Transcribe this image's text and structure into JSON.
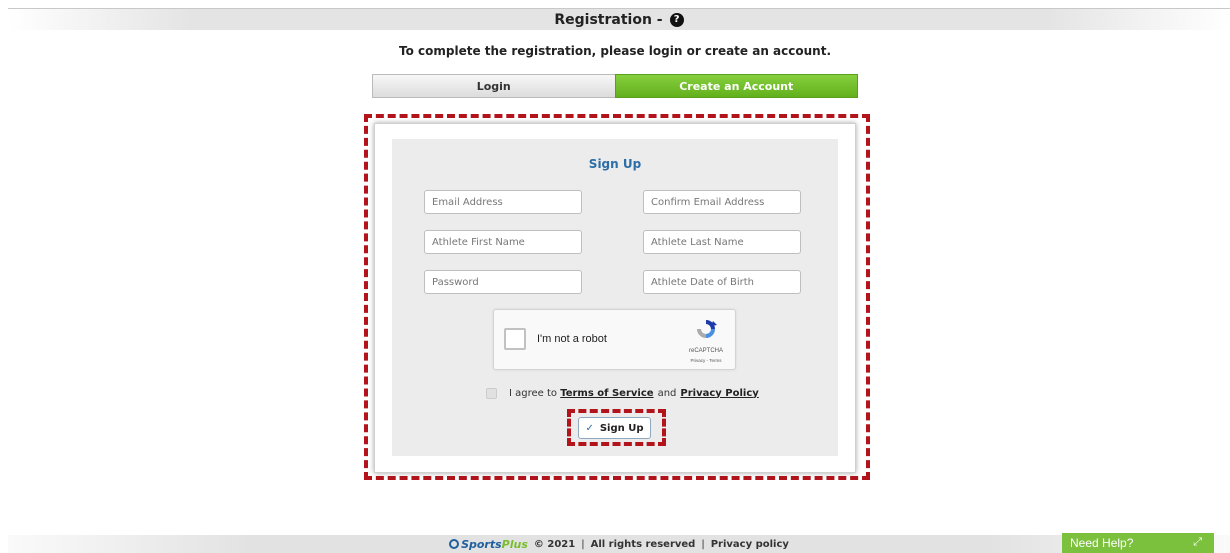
{
  "header": {
    "title": "Registration - ",
    "help_icon": "question-circle-icon"
  },
  "subtitle": "To complete the registration, please login or create an account.",
  "tabs": [
    {
      "label": "Login",
      "active": false
    },
    {
      "label": "Create an Account",
      "active": true
    }
  ],
  "form": {
    "title": "Sign Up",
    "fields": {
      "email": {
        "placeholder": "Email Address",
        "value": ""
      },
      "confirm_email": {
        "placeholder": "Confirm Email Address",
        "value": ""
      },
      "first_name": {
        "placeholder": "Athlete First Name",
        "value": ""
      },
      "last_name": {
        "placeholder": "Athlete Last Name",
        "value": ""
      },
      "password": {
        "placeholder": "Password",
        "value": ""
      },
      "dob": {
        "placeholder": "Athlete Date of Birth",
        "value": ""
      }
    },
    "recaptcha": {
      "label": "I'm not a robot",
      "brand": "reCAPTCHA",
      "links": "Privacy - Terms"
    },
    "agree": {
      "prefix": "I agree to",
      "terms": "Terms of Service",
      "and": "and",
      "privacy": "Privacy Policy"
    },
    "submit_label": "Sign Up",
    "submit_icon": "check-icon"
  },
  "footer": {
    "brand_sports": "Sports",
    "brand_plus": "Plus",
    "copyright": "© 2021",
    "rights": "All rights reserved",
    "privacy": "Privacy policy",
    "separator": "|"
  },
  "help_widget": {
    "label": "Need Help?",
    "icon": "expand-icon"
  },
  "colors": {
    "accent_green": "#6cb628",
    "highlight_red": "#b3141b",
    "title_blue": "#2c6ea8"
  }
}
